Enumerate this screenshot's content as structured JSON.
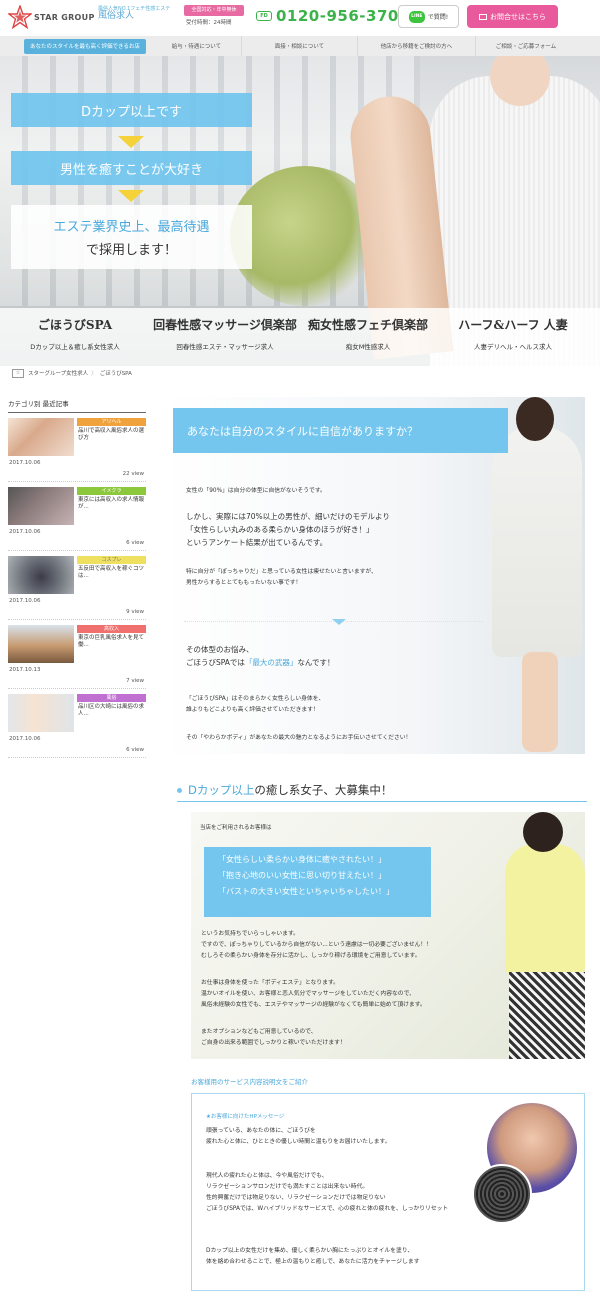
{
  "header": {
    "logo_text": "STAR GROUP",
    "tagline_small": "風俗人気NO.1フェチ性感エステ",
    "tagline_big": "風俗求人",
    "hours_badge": "全国対応・年中無休",
    "hours_text": "受付時間：24時間",
    "phone_label": "FD",
    "phone": "0120-956-370",
    "line_logo": "LINE",
    "line_btn": "で質問!",
    "contact_btn": "お問合せはこちら"
  },
  "nav": {
    "items": [
      "あなたのスタイルを最も高く評価できるお店",
      "給与・待遇について",
      "面接・相談について",
      "他店から移籍をご検討の方へ",
      "ご相談・ご応募フォーム"
    ]
  },
  "hero": {
    "line1": "Dカップ以上です",
    "line2": "男性を癒すことが大好き",
    "line3": "エステ業界史上、最高待遇",
    "line4": "で採用します！",
    "brands": [
      {
        "name": "ごほうびSPA",
        "desc": "Dカップ以上＆癒し系女性求人"
      },
      {
        "name": "回春性感マッサージ倶楽部",
        "desc": "回春性感エステ・マッサージ求人"
      },
      {
        "name": "痴女性感フェチ倶楽部",
        "desc": "痴女M性感求人"
      },
      {
        "name": "ハーフ&ハーフ 人妻",
        "desc": "人妻デリヘル・ヘルス求人"
      }
    ]
  },
  "breadcrumb": {
    "home": "☆",
    "items": [
      "スターグループ女性求人",
      "ごほうびSPA"
    ]
  },
  "sidebar": {
    "title": "カテゴリ別 最近記事",
    "articles": [
      {
        "tag": "アリヘル",
        "tag_color": "#f0a23c",
        "title": "品川で高収入風俗求人の選び方",
        "date": "2017.10.06",
        "views": "22 view"
      },
      {
        "tag": "イメクラ",
        "tag_color": "#8cc83c",
        "title": "東京には高収入の求人情報が...",
        "date": "2017.10.06",
        "views": "6 view"
      },
      {
        "tag": "コスプレ",
        "tag_color": "#f0e060",
        "title": "五反田で高収入を稼ぐコツは...",
        "date": "2017.10.06",
        "views": "9 view"
      },
      {
        "tag": "高収入",
        "tag_color": "#f07070",
        "title": "東京の巨乳風俗求人を見て働...",
        "date": "2017.10.13",
        "views": "7 view"
      },
      {
        "tag": "風俗",
        "tag_color": "#c070d0",
        "title": "品川区の大崎には風俗の求人...",
        "date": "2017.10.06",
        "views": "6 view"
      }
    ]
  },
  "sec1": {
    "title": "あなたは自分のスタイルに自信がありますか？",
    "p1": "女性の「90%」は自分の体型に自信がないそうです。",
    "p2a": "しかし、実際には70%以上の男性が、細いだけのモデルより",
    "p2b": "「女性らしい丸みのある柔らかい身体のほうが好き！」",
    "p2c": "というアンケート結果が出ているんです。",
    "p3a": "特に自分が「ぽっちゃりだ」と思っている女性は痩せたいと言いますが、",
    "p3b": "男性からするととてももったいない事です！",
    "p4a": "その体型のお悩み、",
    "p4b_pre": "ごほうびSPAでは",
    "p4b_hl": "「最大の武器」",
    "p4b_post": "なんです！",
    "p5a": "「ごほうびSPA」はそのまらかく女性らしい身体を、",
    "p5b": "誰よりもどこよりも高く評価させていただきます！",
    "p6": "その「やわらかボディ」があなたの最大の魅力となるようにお手伝いさせてください！"
  },
  "sec2": {
    "heading_hl": "Dカップ以上",
    "heading_rest": "の癒し系女子、大募集中！",
    "sub": "当店をご利用されるお客様は",
    "box": [
      "「女性らしい柔らかい身体に癒やされたい！」",
      "「抱き心地のいい女性に思い切り甘えたい！」",
      "「バストの大きい女性といちゃいちゃしたい！」"
    ],
    "p1": [
      "というお気持ちでいらっしゃいます。",
      "ですので、ぽっちゃりしているから自信がない...という遠慮は一切必要ございません！！",
      "むしろその柔らかい身体を存分に活かし、しっかり稼げる環境をご用意しています。"
    ],
    "p2": [
      "お仕事は身体を使った「ボディエステ」となります。",
      "温かいオイルを使い、お客様と恋人気分でマッサージをしていただく内容なので、",
      "風俗未経験の女性でも、エステやマッサージの経験がなくても簡単に始めて頂けます。"
    ],
    "p3": [
      "またオプションなどもご用意しているので、",
      "ご自身の出来る範囲でしっかりと稼いでいただけます！"
    ]
  },
  "sec3": {
    "heading": "お客様用のサービス内容説明文をご紹介",
    "sub": "★お客様に向けたHPメッセージ",
    "p1": [
      "頑張っている、あなたの体に、ごほうびを",
      "疲れた心と体に、ひとときの優しい時間と温もりをお届けいたします。"
    ],
    "p2": [
      "現代人の疲れた心と体は、今や風俗だけでも、",
      "リラクゼーションサロンだけでも満たすことは出来ない時代。",
      "性的興奮だけでは物足りない、リラクゼーションだけでは物足りない",
      "ごほうびSPAでは、Wハイブリッドなサービスで、心の疲れと体の疲れを、しっかりリセット"
    ],
    "p3": [
      "Dカップ以上の女性だけを集め、優しく柔らかい胸にたっぷりとオイルを塗り、",
      "体を絡め合わせることで、極上の温もりと癒しで、あなたに活力をチャージします"
    ]
  }
}
